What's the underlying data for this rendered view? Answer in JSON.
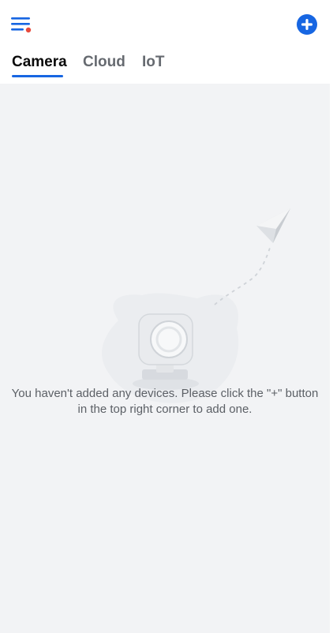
{
  "header": {
    "menu_icon": "menu-icon",
    "add_icon": "add-circle-icon",
    "accent_color": "#1766e2",
    "menu_badge_color": "#e84a3c"
  },
  "tabs": [
    {
      "label": "Camera",
      "active": true
    },
    {
      "label": "Cloud",
      "active": false
    },
    {
      "label": "IoT",
      "active": false
    }
  ],
  "empty_state": {
    "illustration": "camera-paper-plane-illustration",
    "message": "You haven't added any devices. Please click the \"+\" button in the top right corner to add one."
  }
}
